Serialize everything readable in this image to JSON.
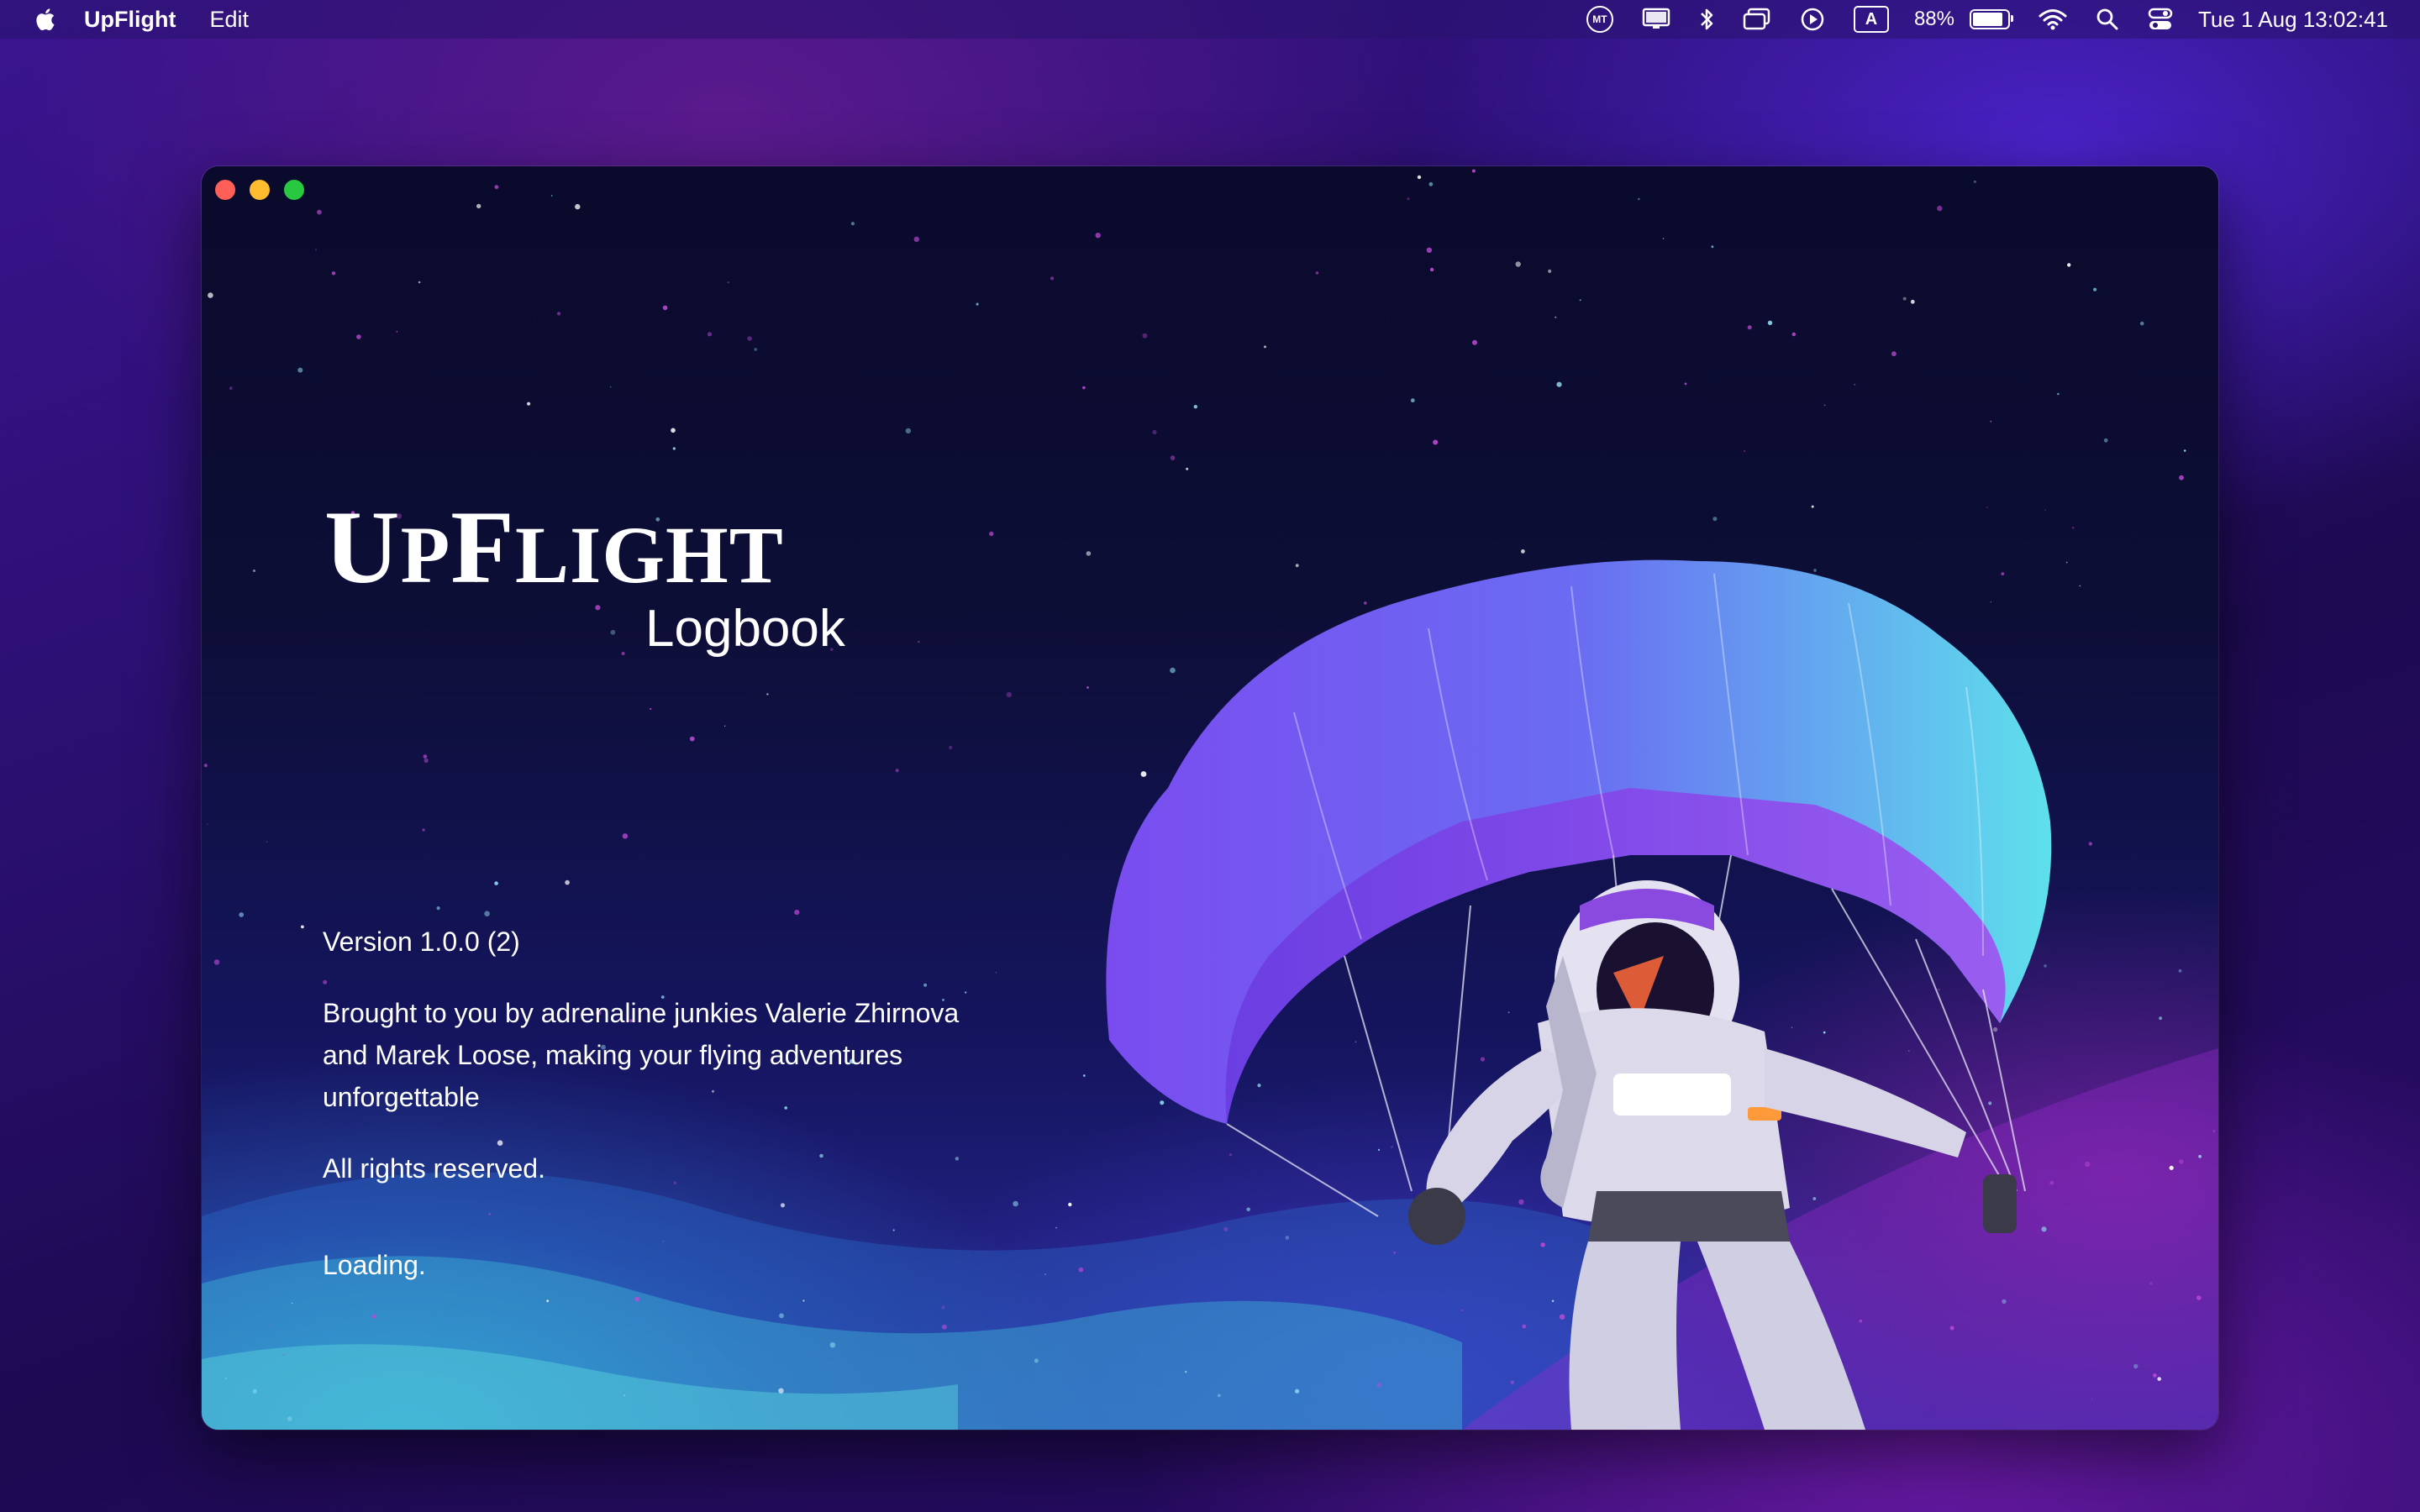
{
  "menubar": {
    "apple_icon": "apple-logo-icon",
    "app_name": "UpFlight",
    "menus": [
      "Edit"
    ],
    "status_icons": [
      "mt-keyboard-icon",
      "display-icon",
      "bluetooth-icon",
      "window-stack-icon",
      "play-circle-icon",
      "input-source-icon",
      "battery-icon",
      "wifi-icon",
      "search-icon",
      "control-center-icon"
    ],
    "mt_badge": "MT",
    "input_source_badge": "A",
    "battery_percent": "88%",
    "battery_level": 0.88,
    "datetime": "Tue 1 Aug  13:02:41"
  },
  "window": {
    "title_main_first": "U",
    "title_main_first_small": "P",
    "title_main_second": "F",
    "title_main_second_small": "LIGHT",
    "title_sub": "Logbook",
    "version": "Version 1.0.0 (2)",
    "credits": "Brought to you by adrenaline junkies Valerie Zhirnova and Marek Loose, making your flying adventures unforgettable",
    "rights": "All rights reserved.",
    "status": "Loading."
  },
  "colors": {
    "close": "#ff5f57",
    "minimize": "#febc2e",
    "maximize": "#28c840"
  }
}
